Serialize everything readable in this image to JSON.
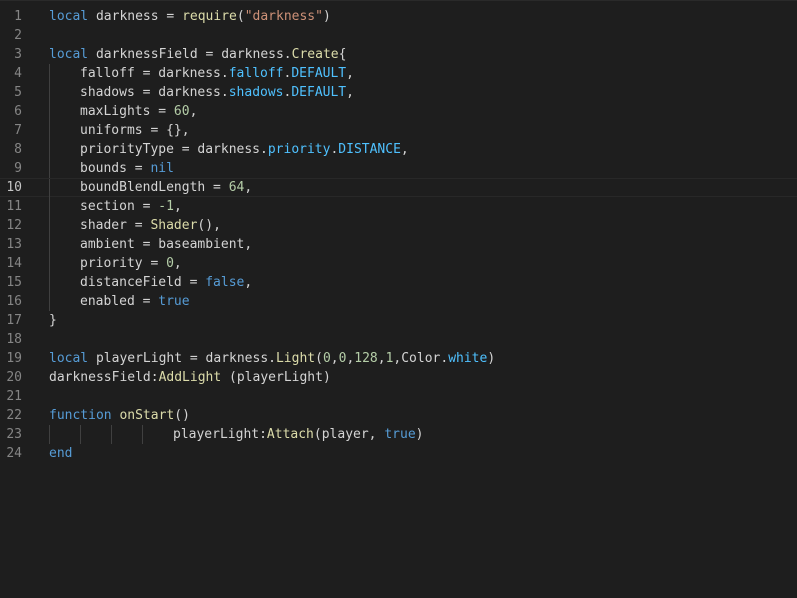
{
  "editor": {
    "language": "lua",
    "current_line": 10,
    "theme_colors": {
      "background": "#1e1e1e",
      "text": "#d4d4d4",
      "line_number": "#858585",
      "keyword": "#569cd6",
      "function": "#dcdcaa",
      "string": "#ce9178",
      "number": "#b5cea8",
      "property": "#4fc1ff"
    },
    "lines": [
      {
        "num": "1",
        "indent": 0,
        "tokens": [
          [
            "kw",
            "local"
          ],
          [
            "tx",
            " darkness = "
          ],
          [
            "fn",
            "require"
          ],
          [
            "tx",
            "("
          ],
          [
            "str",
            "\"darkness\""
          ],
          [
            "tx",
            ")"
          ]
        ]
      },
      {
        "num": "2",
        "indent": 0,
        "tokens": []
      },
      {
        "num": "3",
        "indent": 0,
        "tokens": [
          [
            "kw",
            "local"
          ],
          [
            "tx",
            " darknessField = darkness."
          ],
          [
            "fn",
            "Create"
          ],
          [
            "tx",
            "{"
          ]
        ]
      },
      {
        "num": "4",
        "indent": 1,
        "tokens": [
          [
            "tx",
            "falloff = darkness."
          ],
          [
            "prop",
            "falloff"
          ],
          [
            "tx",
            "."
          ],
          [
            "prop",
            "DEFAULT"
          ],
          [
            "tx",
            ","
          ]
        ]
      },
      {
        "num": "5",
        "indent": 1,
        "tokens": [
          [
            "tx",
            "shadows = darkness."
          ],
          [
            "prop",
            "shadows"
          ],
          [
            "tx",
            "."
          ],
          [
            "prop",
            "DEFAULT"
          ],
          [
            "tx",
            ","
          ]
        ]
      },
      {
        "num": "6",
        "indent": 1,
        "tokens": [
          [
            "tx",
            "maxLights = "
          ],
          [
            "num",
            "60"
          ],
          [
            "tx",
            ","
          ]
        ]
      },
      {
        "num": "7",
        "indent": 1,
        "tokens": [
          [
            "tx",
            "uniforms = {},"
          ]
        ]
      },
      {
        "num": "8",
        "indent": 1,
        "tokens": [
          [
            "tx",
            "priorityType = darkness."
          ],
          [
            "prop",
            "priority"
          ],
          [
            "tx",
            "."
          ],
          [
            "prop",
            "DISTANCE"
          ],
          [
            "tx",
            ","
          ]
        ]
      },
      {
        "num": "9",
        "indent": 1,
        "tokens": [
          [
            "tx",
            "bounds = "
          ],
          [
            "kw",
            "nil"
          ]
        ]
      },
      {
        "num": "10",
        "indent": 1,
        "tokens": [
          [
            "tx",
            "boundBlendLength = "
          ],
          [
            "num",
            "64"
          ],
          [
            "tx",
            ","
          ]
        ]
      },
      {
        "num": "11",
        "indent": 1,
        "tokens": [
          [
            "tx",
            "section = "
          ],
          [
            "num",
            "-1"
          ],
          [
            "tx",
            ","
          ]
        ]
      },
      {
        "num": "12",
        "indent": 1,
        "tokens": [
          [
            "tx",
            "shader = "
          ],
          [
            "fn",
            "Shader"
          ],
          [
            "tx",
            "(),"
          ]
        ]
      },
      {
        "num": "13",
        "indent": 1,
        "tokens": [
          [
            "tx",
            "ambient = baseambient,"
          ]
        ]
      },
      {
        "num": "14",
        "indent": 1,
        "tokens": [
          [
            "tx",
            "priority = "
          ],
          [
            "num",
            "0"
          ],
          [
            "tx",
            ","
          ]
        ]
      },
      {
        "num": "15",
        "indent": 1,
        "tokens": [
          [
            "tx",
            "distanceField = "
          ],
          [
            "kw",
            "false"
          ],
          [
            "tx",
            ","
          ]
        ]
      },
      {
        "num": "16",
        "indent": 1,
        "tokens": [
          [
            "tx",
            "enabled = "
          ],
          [
            "kw",
            "true"
          ]
        ]
      },
      {
        "num": "17",
        "indent": 0,
        "tokens": [
          [
            "tx",
            "}"
          ]
        ]
      },
      {
        "num": "18",
        "indent": 0,
        "tokens": []
      },
      {
        "num": "19",
        "indent": 0,
        "tokens": [
          [
            "kw",
            "local"
          ],
          [
            "tx",
            " playerLight = darkness."
          ],
          [
            "fn",
            "Light"
          ],
          [
            "tx",
            "("
          ],
          [
            "num",
            "0"
          ],
          [
            "tx",
            ","
          ],
          [
            "num",
            "0"
          ],
          [
            "tx",
            ","
          ],
          [
            "num",
            "128"
          ],
          [
            "tx",
            ","
          ],
          [
            "num",
            "1"
          ],
          [
            "tx",
            ",Color."
          ],
          [
            "prop",
            "white"
          ],
          [
            "tx",
            ")"
          ]
        ]
      },
      {
        "num": "20",
        "indent": 0,
        "tokens": [
          [
            "tx",
            "darknessField:"
          ],
          [
            "fn",
            "AddLight"
          ],
          [
            "tx",
            " (playerLight)"
          ]
        ]
      },
      {
        "num": "21",
        "indent": 0,
        "tokens": []
      },
      {
        "num": "22",
        "indent": 0,
        "tokens": [
          [
            "kw",
            "function"
          ],
          [
            "tx",
            " "
          ],
          [
            "fn",
            "onStart"
          ],
          [
            "tx",
            "()"
          ]
        ]
      },
      {
        "num": "23",
        "indent": 4,
        "tokens": [
          [
            "tx",
            "playerLight:"
          ],
          [
            "fn",
            "Attach"
          ],
          [
            "tx",
            "(player, "
          ],
          [
            "kw",
            "true"
          ],
          [
            "tx",
            ")"
          ]
        ]
      },
      {
        "num": "24",
        "indent": 0,
        "tokens": [
          [
            "kw",
            "end"
          ]
        ]
      }
    ]
  }
}
